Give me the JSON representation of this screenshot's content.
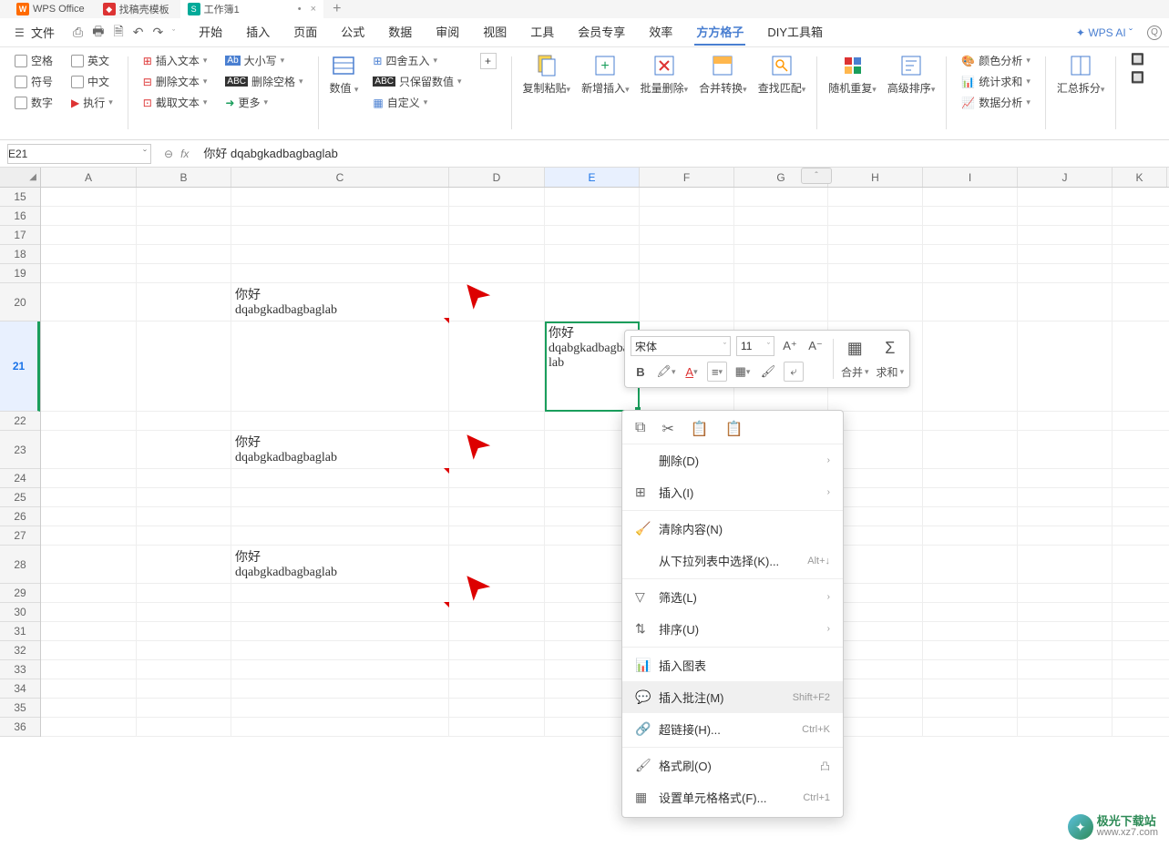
{
  "titlebar": {
    "tabs": [
      {
        "icon": "W",
        "label": "WPS Office"
      },
      {
        "icon": "R",
        "label": "找稿壳模板"
      },
      {
        "icon": "S",
        "label": "工作簿1",
        "close": "×",
        "dirty": "•"
      }
    ],
    "plus": "+"
  },
  "menubar": {
    "file": "文件",
    "tabs": [
      "开始",
      "插入",
      "页面",
      "公式",
      "数据",
      "审阅",
      "视图",
      "工具",
      "会员专享",
      "效率",
      "方方格子",
      "DIY工具箱"
    ],
    "active": "方方格子",
    "ai": "WPS AI",
    "q": "Q"
  },
  "ribbon": {
    "g1": [
      {
        "l": "空格"
      },
      {
        "l": "符号"
      },
      {
        "l": "数字"
      }
    ],
    "g1b": [
      {
        "l": "英文"
      },
      {
        "l": "中文"
      },
      {
        "l": "执行"
      }
    ],
    "g2": [
      {
        "l": "插入文本"
      },
      {
        "l": "删除文本"
      },
      {
        "l": "截取文本"
      }
    ],
    "g3": [
      {
        "l": "大小写"
      },
      {
        "l": "删除空格"
      },
      {
        "l": "更多"
      }
    ],
    "g4": {
      "l": "数值"
    },
    "g5": [
      {
        "l": "四舍五入"
      },
      {
        "l": "只保留数值"
      },
      {
        "l": "自定义"
      }
    ],
    "g5b": {
      "plus": "+"
    },
    "g6": [
      {
        "l": "复制粘贴"
      },
      {
        "l": "新增插入"
      },
      {
        "l": "批量删除"
      },
      {
        "l": "合并转换"
      },
      {
        "l": "查找匹配"
      }
    ],
    "g7": [
      {
        "l": "随机重复"
      },
      {
        "l": "高级排序"
      }
    ],
    "g8": [
      {
        "l": "颜色分析"
      },
      {
        "l": "统计求和"
      },
      {
        "l": "数据分析"
      }
    ],
    "g9": {
      "l": "汇总拆分"
    }
  },
  "formulabar": {
    "cellref": "E21",
    "content": "你好\ndqabgkadbagbaglab"
  },
  "columns": [
    "A",
    "B",
    "C",
    "D",
    "E",
    "F",
    "G",
    "H",
    "I",
    "J",
    "K"
  ],
  "rows": [
    "15",
    "16",
    "17",
    "18",
    "19",
    "20",
    "21",
    "22",
    "23",
    "24",
    "25",
    "26",
    "27",
    "28",
    "29",
    "30",
    "31",
    "32",
    "33",
    "34",
    "35",
    "36"
  ],
  "cells": {
    "C20": "你好\ndqabgkadbagbaglab",
    "C23": "你好\ndqabgkadbagbaglab",
    "C28": "你好\ndqabgkadbagbaglab",
    "E21": "你好\ndqabgkadbagbaglab"
  },
  "mini": {
    "font": "宋体",
    "size": "11",
    "merge": "合并",
    "sum": "求和"
  },
  "context": {
    "delete": "删除(D)",
    "insert": "插入(I)",
    "clear": "清除内容(N)",
    "dropdown": "从下拉列表中选择(K)...",
    "dropdown_sc": "Alt+↓",
    "filter": "筛选(L)",
    "sort": "排序(U)",
    "chart": "插入图表",
    "comment": "插入批注(M)",
    "comment_sc": "Shift+F2",
    "link": "超链接(H)...",
    "link_sc": "Ctrl+K",
    "fmtbrush": "格式刷(O)",
    "cellformat": "设置单元格格式(F)...",
    "cellformat_sc": "Ctrl+1"
  },
  "watermark": {
    "t1": "极光下载站",
    "t2": "www.xz7.com"
  }
}
